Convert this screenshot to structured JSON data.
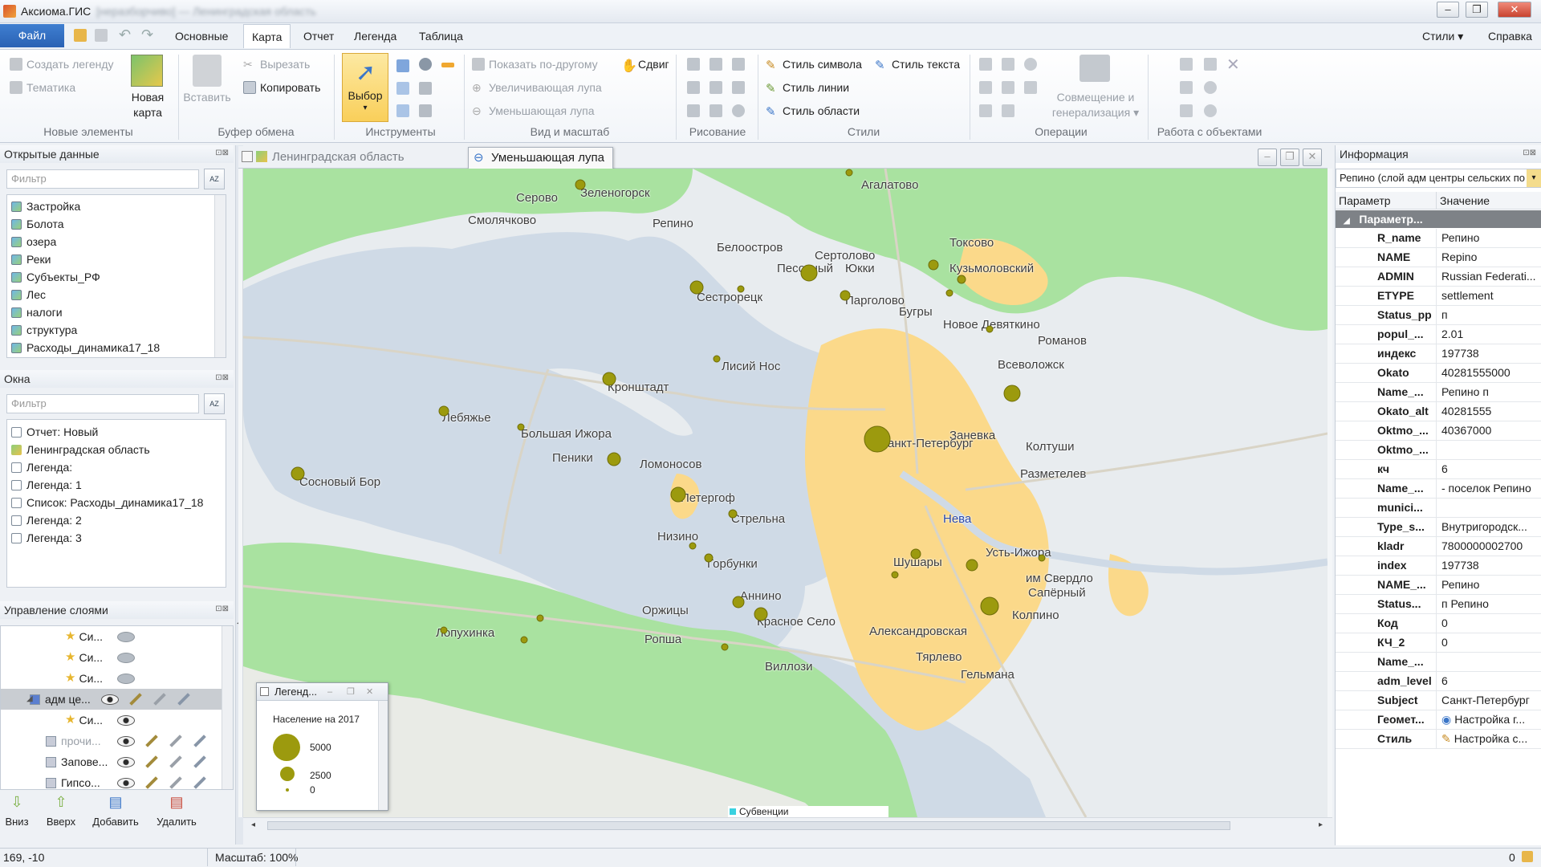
{
  "app": {
    "title": "Аксиома.ГИС",
    "title_blurred": "[неразборчиво] — Ленинградская область"
  },
  "tabs": {
    "file": "Файл",
    "items": [
      "Основные",
      "Карта",
      "Отчет",
      "Легенда",
      "Таблица"
    ],
    "active": "Карта",
    "styles": "Стили",
    "help": "Справка"
  },
  "ribbon": {
    "new_elements": {
      "label": "Новые элементы",
      "create_legend": "Создать легенду",
      "thematic": "Тематика",
      "new_map_1": "Новая",
      "new_map_2": "карта"
    },
    "clipboard": {
      "label": "Буфер обмена",
      "paste": "Вставить",
      "cut": "Вырезать",
      "copy": "Копировать"
    },
    "tools": {
      "label": "Инструменты",
      "select": "Выбор"
    },
    "view": {
      "label": "Вид и масштаб",
      "show_other": "Показать по-другому",
      "shift": "Сдвиг",
      "zoom_in": "Увеличивающая лупа",
      "zoom_out": "Уменьшающая лупа"
    },
    "drawing": {
      "label": "Рисование"
    },
    "styles": {
      "label": "Стили",
      "symbol_style": "Стиль символа",
      "text_style": "Стиль текста",
      "line_style": "Стиль линии",
      "area_style": "Стиль области"
    },
    "operations": {
      "label": "Операции",
      "combine_1": "Совмещение и",
      "combine_2": "генерализация"
    },
    "objects": {
      "label": "Работа с объектами"
    }
  },
  "open_data": {
    "title": "Открытые данные",
    "filter_placeholder": "Фильтр",
    "items": [
      "Застройка",
      "Болота",
      "озера",
      "Реки",
      "Субъекты_РФ",
      "Лес",
      "налоги",
      "структура",
      "Расходы_динамика17_18"
    ]
  },
  "windows": {
    "title": "Окна",
    "filter_placeholder": "Фильтр",
    "items": [
      "Отчет: Новый",
      "Ленинградская область",
      "Легенда:",
      "Легенда:  1",
      "Список: Расходы_динамика17_18",
      "Легенда:  2",
      "Легенда:  3"
    ]
  },
  "layers": {
    "title": "Управление слоями",
    "rows": [
      "Си...",
      "Си...",
      "Си...",
      "адм це...",
      "Си...",
      "прочи...",
      "Запове...",
      "Гипсо..."
    ],
    "buttons": {
      "down": "Вниз",
      "up": "Вверх",
      "add": "Добавить",
      "remove": "Удалить"
    }
  },
  "map_window": {
    "tab_title": "Ленинградская область",
    "tooltip": "Уменьшающая лупа",
    "labels": [
      "Агалатово",
      "Серово",
      "Зеленогорск",
      "Смолячково",
      "Репино",
      "Токсово",
      "Белоостров",
      "Сертолово",
      "Песочный",
      "Юкки",
      "Кузьмоловский",
      "Сестрорецк",
      "Парголово",
      "Бугры",
      "Новое Девяткино",
      "Романов",
      "Лисий Нос",
      "Всеволожск",
      "Кронштадт",
      "Лебяжье",
      "Большая Ижора",
      "Заневка",
      "Санкт-Петербург",
      "Колтуши",
      "Пеники",
      "Ломоносов",
      "Разметелев",
      "Сосновый Бор",
      "Петергоф",
      "Стрельна",
      "Нева",
      "Низино",
      "Усть-Ижора",
      "Горбунки",
      "Шушары",
      "им Свердло",
      "Сапёрный",
      "Аннино",
      "Оржицы",
      "Красное Село",
      "Колпино",
      "Лопухинка",
      "Ропша",
      "Александровская",
      "Виллози",
      "Тярлево",
      "Гельмана"
    ],
    "scale_strip": "Субвенции"
  },
  "legend_window": {
    "title": "Легенд...",
    "heading": "Население на 2017",
    "entries": [
      {
        "label": "5000"
      },
      {
        "label": "2500"
      },
      {
        "label": "0"
      }
    ]
  },
  "info": {
    "title": "Информация",
    "selector": "Репино (слой адм центры сельских по",
    "col_param": "Параметр",
    "col_value": "Значение",
    "group": "Параметр...",
    "rows": [
      {
        "k": "R_name",
        "v": "Репино"
      },
      {
        "k": "NAME",
        "v": "Repino"
      },
      {
        "k": "ADMIN",
        "v": "Russian Federati..."
      },
      {
        "k": "ETYPE",
        "v": "settlement"
      },
      {
        "k": "Status_pp",
        "v": "п"
      },
      {
        "k": "popul_...",
        "v": "2.01"
      },
      {
        "k": "индекс",
        "v": "197738"
      },
      {
        "k": "Okato",
        "v": "40281555000"
      },
      {
        "k": "Name_...",
        "v": "Репино п"
      },
      {
        "k": "Okato_alt",
        "v": "40281555"
      },
      {
        "k": "Oktmo_...",
        "v": "40367000"
      },
      {
        "k": "Oktmo_...",
        "v": ""
      },
      {
        "k": "кч",
        "v": "6"
      },
      {
        "k": "Name_...",
        "v": "- поселок Репино"
      },
      {
        "k": "munici...",
        "v": ""
      },
      {
        "k": "Type_s...",
        "v": "Внутригородск..."
      },
      {
        "k": "kladr",
        "v": "7800000002700"
      },
      {
        "k": "index",
        "v": "197738"
      },
      {
        "k": "NAME_...",
        "v": "Репино"
      },
      {
        "k": "Status...",
        "v": "п Репино"
      },
      {
        "k": "Код",
        "v": "0"
      },
      {
        "k": "КЧ_2",
        "v": "0"
      },
      {
        "k": "Name_...",
        "v": ""
      },
      {
        "k": "adm_level",
        "v": "6"
      },
      {
        "k": "Subject",
        "v": "Санкт-Петербург"
      },
      {
        "k": "Геомет...",
        "v": "Настройка г..."
      },
      {
        "k": "Стиль",
        "v": "Настройка с..."
      }
    ]
  },
  "status": {
    "coords": "169, -10",
    "scale": "Масштаб: 100%",
    "right": "0"
  },
  "colors": {
    "accent": "#2b6cc4",
    "water": "#cfdae6",
    "forest": "#a9e2a0",
    "urban": "#fbd98a",
    "symbol": "#9c9a0e"
  }
}
